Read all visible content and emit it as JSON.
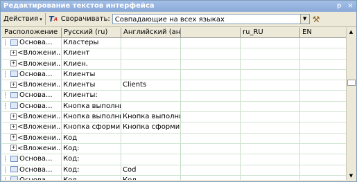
{
  "window": {
    "title": "Редактирование текстов интерфейса",
    "pin": "ᵽ",
    "close": "×"
  },
  "toolbar": {
    "actions_label": "Действия",
    "compare_label": "Сворачивать:",
    "compare_value": "Совпадающие на всех языках"
  },
  "grid": {
    "columns": [
      "Расположение",
      "Русский (ru)",
      "Английский (англ)",
      "",
      "ru_RU",
      "EN"
    ],
    "rows": [
      {
        "loc": "Основа...",
        "ru": "Кластеры",
        "en": "",
        "kind": "leaf"
      },
      {
        "loc": "<Вложени...",
        "ru": "Клиент",
        "en": "",
        "kind": "node"
      },
      {
        "loc": "<Вложени...",
        "ru": "Клиен.",
        "en": "",
        "kind": "node"
      },
      {
        "loc": "Основа...",
        "ru": "Клиенты",
        "en": "",
        "kind": "leaf"
      },
      {
        "loc": "<Вложени...",
        "ru": "Клиенты",
        "en": "Clients",
        "kind": "node"
      },
      {
        "loc": "Основа...",
        "ru": "Клиенты:",
        "en": "",
        "kind": "leaf"
      },
      {
        "loc": "Основа...",
        "ru": "Кнопка выполни..",
        "en": "",
        "kind": "leaf"
      },
      {
        "loc": "<Вложени...",
        "ru": "Кнопка выполни...",
        "en": "Кнопка выполни...",
        "kind": "node"
      },
      {
        "loc": "<Вложени...",
        "ru": "Кнопка сформир...",
        "en": "Кнопка сформир...",
        "kind": "node"
      },
      {
        "loc": "<Вложени...",
        "ru": "Код",
        "en": "",
        "kind": "node"
      },
      {
        "loc": "<Вложени...",
        "ru": "Код:",
        "en": "",
        "kind": "node"
      },
      {
        "loc": "Основа...",
        "ru": "Код:",
        "en": "",
        "kind": "leaf"
      },
      {
        "loc": "Основа...",
        "ru": "Код:",
        "en": "Cod",
        "kind": "leaf"
      },
      {
        "loc": "Основа...",
        "ru": "Код",
        "en": "Код",
        "kind": "leaf"
      }
    ]
  },
  "icons": {
    "actions_arrow": "dropdown-arrow",
    "tool_icon": "translate-icon",
    "hammer_icon": "tool-icon"
  }
}
